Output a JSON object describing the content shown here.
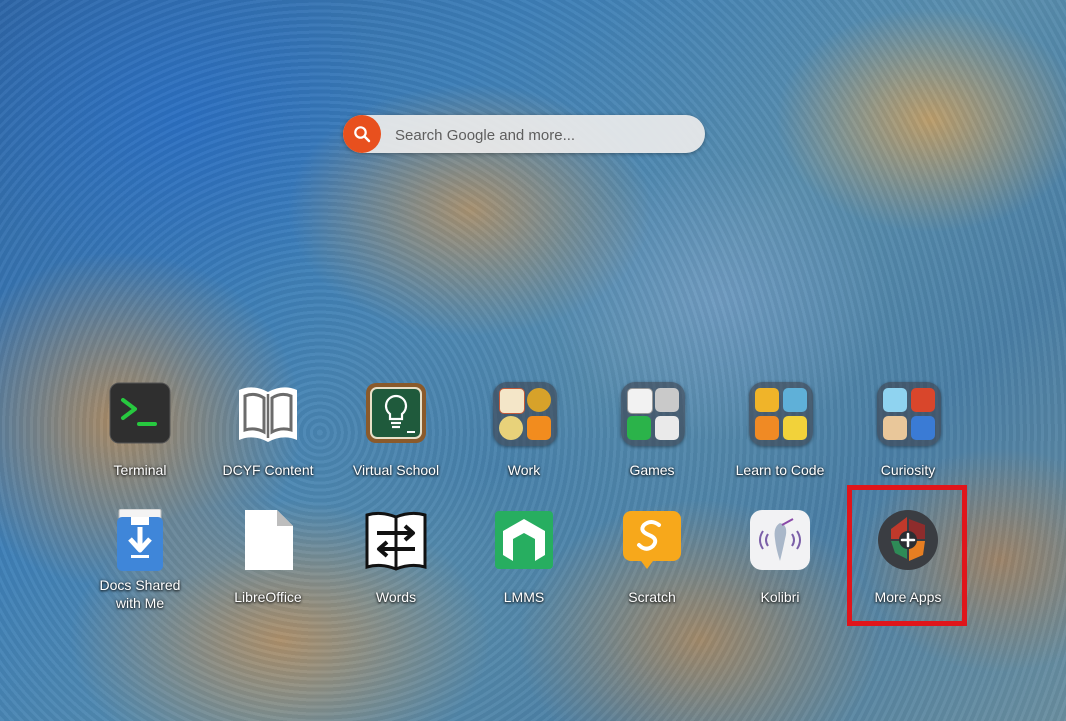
{
  "search": {
    "placeholder": "Search Google and more..."
  },
  "apps_row1": [
    {
      "label": "Terminal",
      "icon": "terminal-icon"
    },
    {
      "label": "DCYF Content",
      "icon": "open-book-icon"
    },
    {
      "label": "Virtual School",
      "icon": "chalkboard-lightbulb-icon"
    },
    {
      "label": "Work",
      "icon": "folder-icon"
    },
    {
      "label": "Games",
      "icon": "folder-icon"
    },
    {
      "label": "Learn to Code",
      "icon": "folder-icon"
    },
    {
      "label": "Curiosity",
      "icon": "folder-icon"
    }
  ],
  "apps_row2": [
    {
      "label_line1": "Docs Shared",
      "label_line2": "with Me",
      "icon": "download-document-icon"
    },
    {
      "label": "LibreOffice",
      "icon": "libreoffice-document-icon"
    },
    {
      "label": "Words",
      "icon": "words-arrows-icon"
    },
    {
      "label": "LMMS",
      "icon": "lmms-icon"
    },
    {
      "label": "Scratch",
      "icon": "scratch-icon"
    },
    {
      "label": "Kolibri",
      "icon": "kolibri-hummingbird-icon"
    },
    {
      "label": "More Apps",
      "icon": "more-apps-plus-icon"
    }
  ],
  "colors": {
    "search_accent": "#e8501e",
    "highlight_box": "#e0151b",
    "terminal_prompt": "#27c93f",
    "lmms_green": "#27ae60",
    "scratch_orange": "#f7a81b"
  }
}
